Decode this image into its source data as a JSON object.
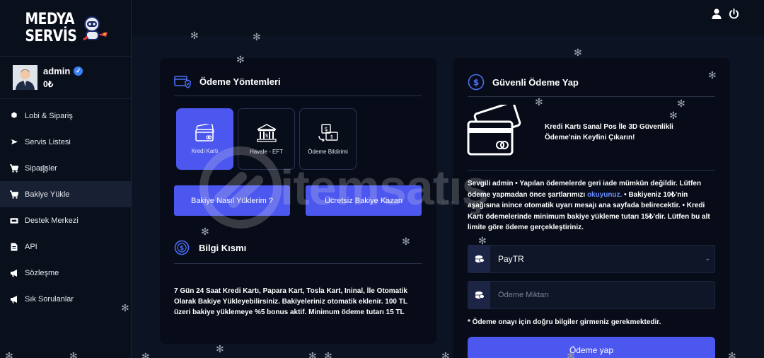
{
  "brand": {
    "line1": "MEDYA",
    "line2": "SERVİS"
  },
  "user": {
    "name": "admin",
    "balance": "0₺"
  },
  "nav": [
    {
      "label": "Lobi & Sipariş",
      "icon": "cube-icon"
    },
    {
      "label": "Servis Listesi",
      "icon": "send-icon"
    },
    {
      "label": "Siparişler",
      "icon": "cart-icon"
    },
    {
      "label": "Bakiye Yükle",
      "icon": "cart-icon"
    },
    {
      "label": "Destek Merkezi",
      "icon": "ticket-icon"
    },
    {
      "label": "API",
      "icon": "document-icon"
    },
    {
      "label": "Sözleşme",
      "icon": "megaphone-icon"
    },
    {
      "label": "Sık Sorulanlar",
      "icon": "megaphone-icon"
    }
  ],
  "topbar": {
    "icons": [
      "user-icon",
      "power-icon"
    ]
  },
  "payment": {
    "title": "Ödeme Yöntemleri",
    "methods": [
      {
        "label": "Kredi Kartı",
        "icon": "credit-card-icon",
        "active": true
      },
      {
        "label": "Havale - EFT",
        "icon": "bank-icon",
        "active": false
      },
      {
        "label": "Ödeme Bildirimi",
        "icon": "money-transfer-icon",
        "active": false
      }
    ],
    "btn_how": "Bakiye Nasıl Yüklerim ?",
    "btn_free": "Ücretsiz Bakiye Kazan"
  },
  "info": {
    "title": "Bilgi Kısmı",
    "text": "7 Gün 24 Saat Kredi Kartı, Papara Kart, Tosla Kart, Ininal, İle Otomatik Olarak Bakiye Yükleyebilirsiniz. Bakiyeleriniz otomatik eklenir. 100 TL üzeri bakiye yüklemeye %5 bonus aktif. Minimum ödeme tutarı 15 TL"
  },
  "secure": {
    "title": "Güvenli Ödeme Yap",
    "promo": "Kredi Kartı Sanal Pos İle 3D Güvenlikli Ödeme'nin Keyfini Çıkarın!",
    "notice_before": "Sevgili admin • Yapılan ödemelerde geri iade mümkün değildir. Lütfen ödeme yapmadan önce şartlarımızı ",
    "notice_link": "okuyunuz.",
    "notice_after": " • Bakiyeniz 10₺'nin aşağısına inince otomatik uyarı mesajı ana sayfada belirecektir. • Kredi Kartı ödemelerinde minimum bakiye yükleme tutarı 15₺'dir. Lütfen bu alt limite göre ödeme gerçekleştiriniz.",
    "provider_value": "PayTR",
    "amount_placeholder": "Ödeme Miktarı",
    "required_note": "* Ödeme onayı için doğru bilgiler girmeniz gerekmektedir.",
    "submit": "Ödeme yap"
  },
  "watermark": {
    "text": "itemsatış",
    "sub": "HESAP / SATIŞ"
  },
  "colors": {
    "accent": "#4c57f0",
    "bg": "#0c1322",
    "card": "#070c18",
    "sidebar": "#0a0f1c"
  }
}
